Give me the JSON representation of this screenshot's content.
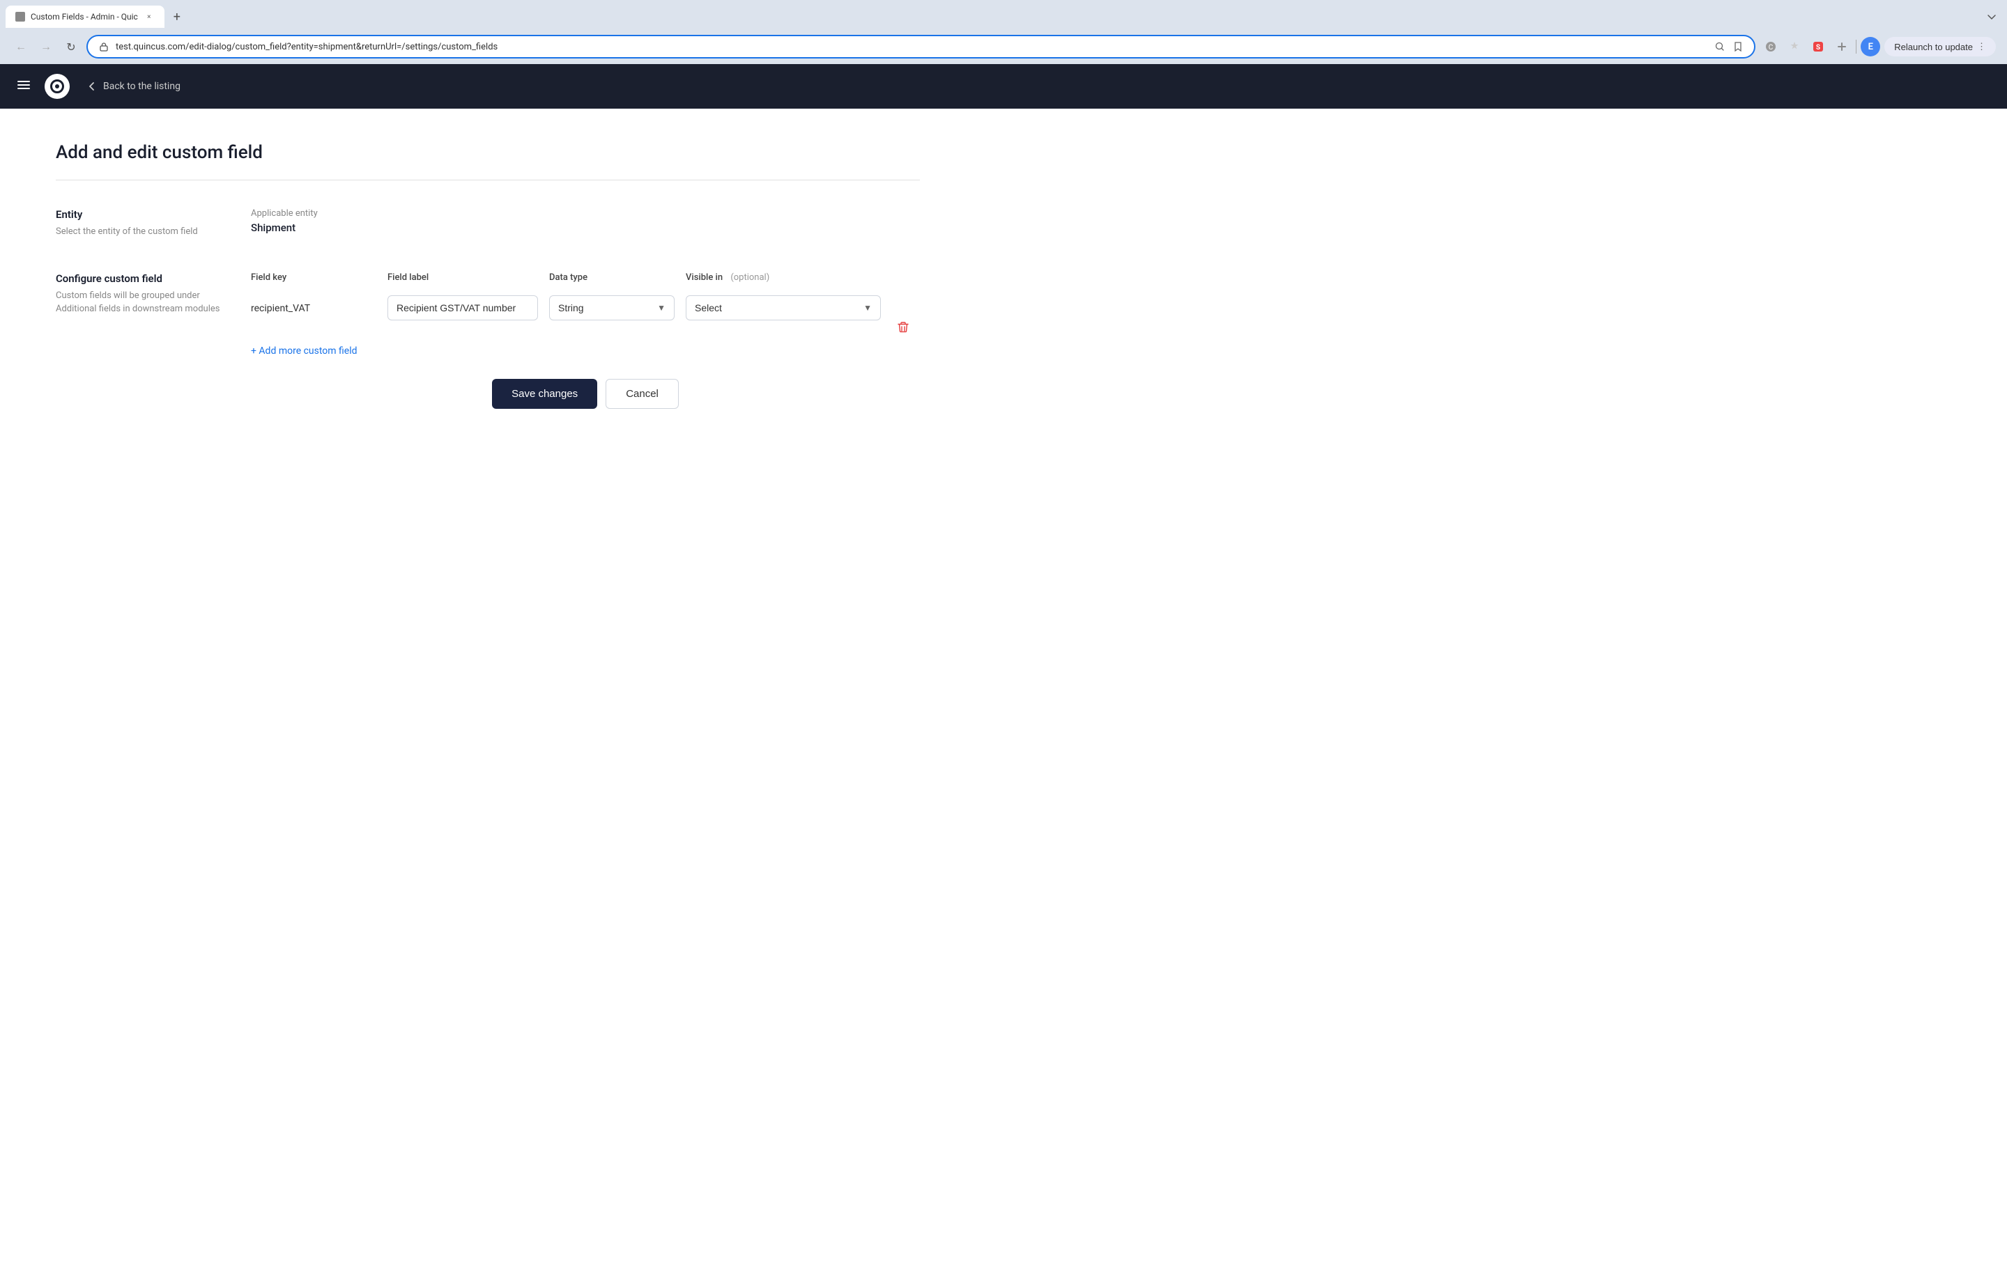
{
  "browser": {
    "tab_title": "Custom Fields - Admin - Quic",
    "tab_close_label": "×",
    "new_tab_label": "+",
    "url": "test.quincus.com/edit-dialog/custom_field?entity=shipment&returnUrl=/settings/custom_fields",
    "relaunch_label": "Relaunch to update",
    "user_initial": "E"
  },
  "nav": {
    "back_label": "Back to the listing"
  },
  "page": {
    "title": "Add and edit custom field"
  },
  "entity_section": {
    "title": "Entity",
    "description": "Select the entity of the custom field",
    "applicable_entity_label": "Applicable entity",
    "entity_value": "Shipment"
  },
  "configure_section": {
    "title": "Configure custom field",
    "description": "Custom fields will be grouped under Additional fields in downstream modules",
    "columns": {
      "field_key": "Field key",
      "field_label": "Field label",
      "data_type": "Data type",
      "visible_in": "Visible in",
      "visible_in_optional": "(optional)"
    },
    "row": {
      "field_key_value": "recipient_VAT",
      "field_label_value": "Recipient GST/VAT number",
      "data_type_value": "String",
      "visible_in_value": "Select"
    },
    "add_more_label": "+ Add more custom field"
  },
  "actions": {
    "save_label": "Save changes",
    "cancel_label": "Cancel"
  }
}
